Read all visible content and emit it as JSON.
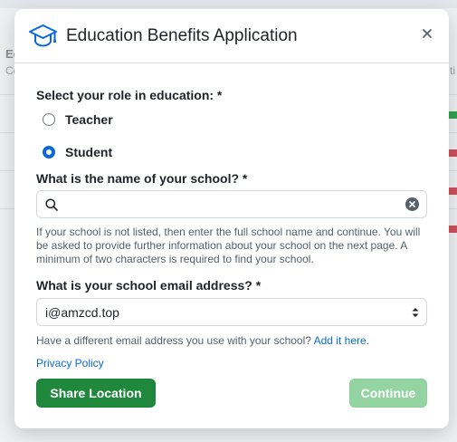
{
  "background": {
    "partial_heading": "Ec",
    "partial_sub_left": "Co",
    "partial_sub_right": "ti",
    "marks": [
      "#2da44e",
      "#cf4f5e",
      "#cf4f5e",
      "#cf4f5e"
    ]
  },
  "modal": {
    "title": "Education Benefits Application",
    "icon": "graduation-cap-icon",
    "close_icon": "close-icon"
  },
  "role": {
    "label": "Select your role in education: *",
    "options": [
      {
        "label": "Teacher",
        "checked": false
      },
      {
        "label": "Student",
        "checked": true
      }
    ]
  },
  "school": {
    "label": "What is the name of your school? *",
    "value": "",
    "placeholder": "",
    "help": "If your school is not listed, then enter the full school name and continue. You will be asked to provide further information about your school on the next page. A minimum of two characters is required to find your school."
  },
  "email": {
    "label": "What is your school email address? *",
    "selected": "i@amzcd.top",
    "alt_text": "Have a different email address you use with your school?",
    "alt_link": "Add it here."
  },
  "privacy_link": "Privacy Policy",
  "buttons": {
    "share_location": "Share Location",
    "continue": "Continue"
  },
  "colors": {
    "accent_blue": "#0969da",
    "primary_green": "#1f883d",
    "disabled_green": "#94d3a2"
  }
}
